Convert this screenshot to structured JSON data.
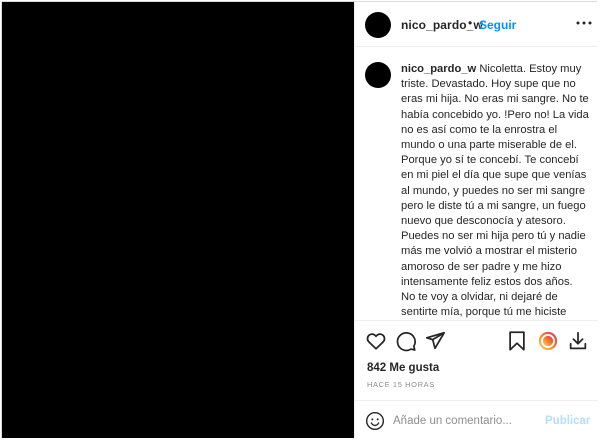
{
  "post": {
    "username": "nico_pardo_w",
    "separator": "•",
    "follow_label": "Seguir",
    "more_icon": "more-horizontal-icon",
    "caption": {
      "username": "nico_pardo_w",
      "text": "Nicoletta. Estoy muy triste. Devastado. Hoy supe que no eras mi hija. No eras mi sangre. No te había concebido yo. !Pero no! La vida no es así como te la enrostra el mundo o una parte miserable de el. Porque yo sí te concebí. Te concebí en mi piel el día que supe que venías al mundo, y puedes no ser mi sangre pero le diste tú a mi sangre, un fuego nuevo que desconocía y atesoro. Puedes no ser mi hija pero tú y nadie más me volvió a mostrar el misterio amoroso de ser padre y me hizo intensamente feliz estos dos años. No te voy a olvidar, ni dejaré de sentirte mía, porque tú me hiciste tuyo, porque un papel no borra lo que escribió el corazón. Hay mucho dolor en este pueblo, mi hija ilustre. De"
    },
    "actions": {
      "like_icon": "heart-icon",
      "comment_icon": "comment-icon",
      "share_icon": "send-icon",
      "save_icon": "bookmark-icon",
      "extra_icon": "story-ring-icon",
      "download_icon": "download-icon"
    },
    "likes_label": "842 Me gusta",
    "time_label": "HACE 15 HORAS",
    "comment_box": {
      "emoji_icon": "emoji-icon",
      "placeholder": "Añade un comentario...",
      "publish_label": "Publicar"
    },
    "colors": {
      "accent": "#0095f6",
      "publish_disabled": "#b2dffc",
      "photo_bg": "#000000"
    }
  }
}
